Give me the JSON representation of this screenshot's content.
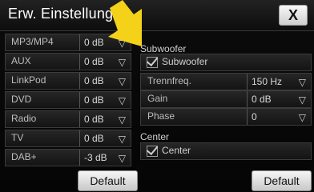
{
  "window": {
    "title": "Erw. Einstellungen",
    "close_label": "X"
  },
  "left_list": [
    {
      "name": "MP3/MP4",
      "value": "0 dB"
    },
    {
      "name": "AUX",
      "value": "0 dB"
    },
    {
      "name": "LinkPod",
      "value": "0 dB"
    },
    {
      "name": "DVD",
      "value": "0 dB"
    },
    {
      "name": "Radio",
      "value": "0 dB"
    },
    {
      "name": "TV",
      "value": "0 dB"
    },
    {
      "name": "DAB+",
      "value": "-3 dB"
    }
  ],
  "dropdown_glyph": "▽",
  "subwoofer": {
    "title": "Subwoofer",
    "checkbox_label": "Subwoofer",
    "params": [
      {
        "label": "Trennfreq.",
        "value": "150 Hz"
      },
      {
        "label": "Gain",
        "value": "0 dB"
      },
      {
        "label": "Phase",
        "value": "0"
      }
    ]
  },
  "center": {
    "title": "Center",
    "checkbox_label": "Center"
  },
  "buttons": {
    "default_left": "Default",
    "default_right": "Default"
  },
  "colors": {
    "arrow": "#f5d21a"
  }
}
